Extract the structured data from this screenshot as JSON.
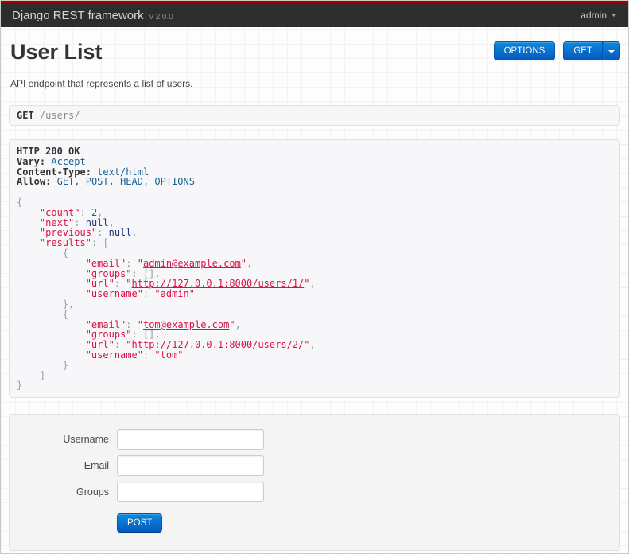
{
  "navbar": {
    "brand": "Django REST framework",
    "version": "v 2.0.0",
    "user_menu": "admin"
  },
  "page": {
    "title": "User List",
    "description": "API endpoint that represents a list of users."
  },
  "toolbar": {
    "options_label": "OPTIONS",
    "get_label": "GET"
  },
  "request_bar": {
    "method": "GET",
    "path": "/users/"
  },
  "response": {
    "lines": [
      [
        [
          "hdr",
          "HTTP 200 OK"
        ]
      ],
      [
        [
          "hdr",
          "Vary:"
        ],
        [
          "pln",
          " "
        ],
        [
          "lit",
          "Accept"
        ]
      ],
      [
        [
          "hdr",
          "Content-Type:"
        ],
        [
          "pln",
          " "
        ],
        [
          "lit",
          "text/html"
        ]
      ],
      [
        [
          "hdr",
          "Allow:"
        ],
        [
          "pln",
          " "
        ],
        [
          "lit",
          "GET, POST, HEAD, OPTIONS"
        ]
      ],
      [],
      [
        [
          "pun",
          "{"
        ]
      ],
      [
        [
          "pln",
          "    "
        ],
        [
          "str",
          "\"count\""
        ],
        [
          "pun",
          ": "
        ],
        [
          "lit",
          "2"
        ],
        [
          "pun",
          ","
        ]
      ],
      [
        [
          "pln",
          "    "
        ],
        [
          "str",
          "\"next\""
        ],
        [
          "pun",
          ": "
        ],
        [
          "kwd",
          "null"
        ],
        [
          "pun",
          ","
        ]
      ],
      [
        [
          "pln",
          "    "
        ],
        [
          "str",
          "\"previous\""
        ],
        [
          "pun",
          ": "
        ],
        [
          "kwd",
          "null"
        ],
        [
          "pun",
          ","
        ]
      ],
      [
        [
          "pln",
          "    "
        ],
        [
          "str",
          "\"results\""
        ],
        [
          "pun",
          ": ["
        ]
      ],
      [
        [
          "pln",
          "        "
        ],
        [
          "pun",
          "{"
        ]
      ],
      [
        [
          "pln",
          "            "
        ],
        [
          "str",
          "\"email\""
        ],
        [
          "pun",
          ": "
        ],
        [
          "str",
          "\""
        ],
        [
          "lnk",
          "admin@example.com"
        ],
        [
          "str",
          "\""
        ],
        [
          "pun",
          ","
        ]
      ],
      [
        [
          "pln",
          "            "
        ],
        [
          "str",
          "\"groups\""
        ],
        [
          "pun",
          ": [],"
        ]
      ],
      [
        [
          "pln",
          "            "
        ],
        [
          "str",
          "\"url\""
        ],
        [
          "pun",
          ": "
        ],
        [
          "str",
          "\""
        ],
        [
          "lnk",
          "http://127.0.0.1:8000/users/1/"
        ],
        [
          "str",
          "\""
        ],
        [
          "pun",
          ","
        ]
      ],
      [
        [
          "pln",
          "            "
        ],
        [
          "str",
          "\"username\""
        ],
        [
          "pun",
          ": "
        ],
        [
          "str",
          "\"admin\""
        ]
      ],
      [
        [
          "pln",
          "        "
        ],
        [
          "pun",
          "},"
        ]
      ],
      [
        [
          "pln",
          "        "
        ],
        [
          "pun",
          "{"
        ]
      ],
      [
        [
          "pln",
          "            "
        ],
        [
          "str",
          "\"email\""
        ],
        [
          "pun",
          ": "
        ],
        [
          "str",
          "\""
        ],
        [
          "lnk",
          "tom@example.com"
        ],
        [
          "str",
          "\""
        ],
        [
          "pun",
          ","
        ]
      ],
      [
        [
          "pln",
          "            "
        ],
        [
          "str",
          "\"groups\""
        ],
        [
          "pun",
          ": [],"
        ]
      ],
      [
        [
          "pln",
          "            "
        ],
        [
          "str",
          "\"url\""
        ],
        [
          "pun",
          ": "
        ],
        [
          "str",
          "\""
        ],
        [
          "lnk",
          "http://127.0.0.1:8000/users/2/"
        ],
        [
          "str",
          "\""
        ],
        [
          "pun",
          ","
        ]
      ],
      [
        [
          "pln",
          "            "
        ],
        [
          "str",
          "\"username\""
        ],
        [
          "pun",
          ": "
        ],
        [
          "str",
          "\"tom\""
        ]
      ],
      [
        [
          "pln",
          "        "
        ],
        [
          "pun",
          "}"
        ]
      ],
      [
        [
          "pln",
          "    "
        ],
        [
          "pun",
          "]"
        ]
      ],
      [
        [
          "pun",
          "}"
        ]
      ]
    ]
  },
  "form": {
    "fields": [
      {
        "label": "Username",
        "value": "",
        "name": "username"
      },
      {
        "label": "Email",
        "value": "",
        "name": "email"
      },
      {
        "label": "Groups",
        "value": "",
        "name": "groups"
      }
    ],
    "submit_label": "POST"
  },
  "colors": {
    "accent_blue": "#0459c0",
    "top_strip_red": "#a30000",
    "navbar_bg": "#2d2d2d",
    "panel_bg": "#f7f7f9",
    "json_string": "#dd1144",
    "json_keyword": "#1e347b",
    "json_literal": "#195f91",
    "json_punctuation": "#93a1a1"
  }
}
